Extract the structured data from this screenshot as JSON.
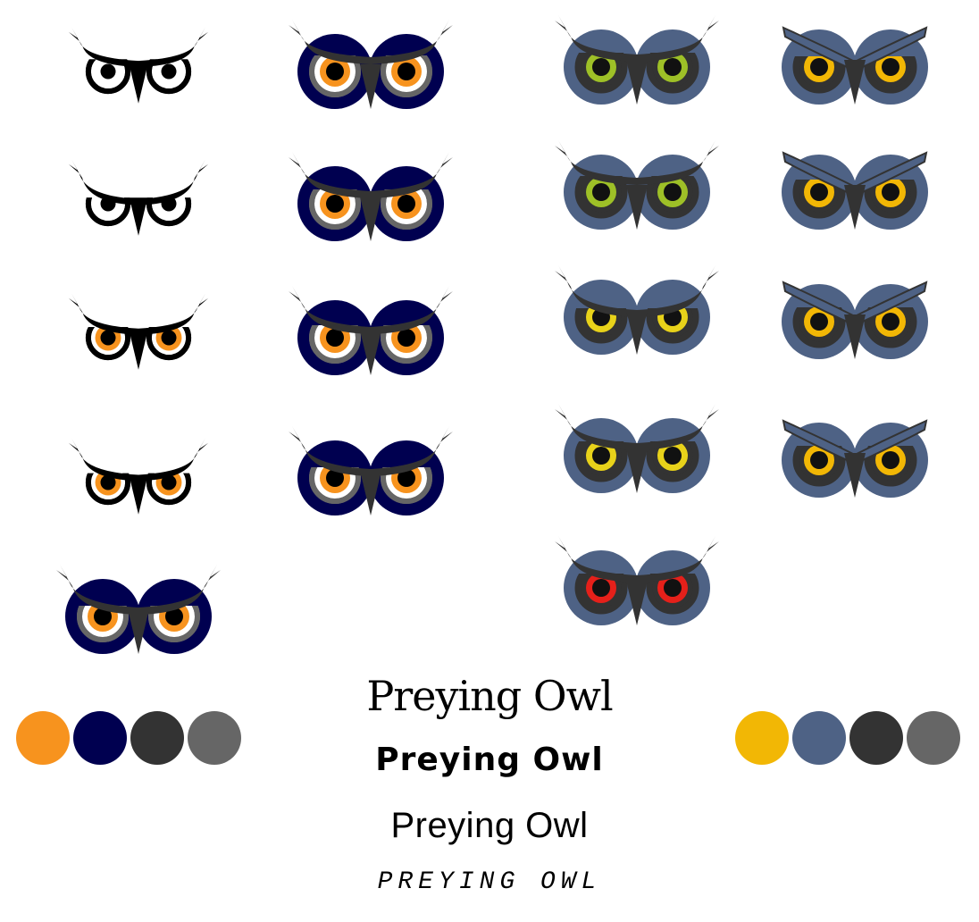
{
  "title_samples": [
    "Preying Owl",
    "Preying Owl",
    "Preying Owl",
    "PREYING OWL"
  ],
  "palettes": {
    "left": [
      "#f7931e",
      "#000050",
      "#333333",
      "#666666"
    ],
    "right": [
      "#f2b705",
      "#4e6285",
      "#333333",
      "#666666"
    ]
  },
  "owls": [
    {
      "style": "outline",
      "iris": "#ffffff",
      "lid": 0.3
    },
    {
      "style": "outline",
      "iris": "#ffffff",
      "lid": 0.5
    },
    {
      "style": "outline",
      "iris": "#f7931e",
      "lid": 0.35
    },
    {
      "style": "outline",
      "iris": "#f7931e",
      "lid": 0.4
    },
    {
      "style": "navy",
      "iris": "#f7931e",
      "lid": 0.4
    },
    {
      "style": "navy",
      "iris": "#f7931e",
      "lid": 0.25
    },
    {
      "style": "navy",
      "iris": "#f7931e",
      "lid": 0.3
    },
    {
      "style": "navy",
      "iris": "#f7931e",
      "lid": 0.35
    },
    {
      "style": "navy",
      "iris": "#f7931e",
      "lid": 0.4
    },
    {
      "style": "slate",
      "iris": "#9ec027",
      "lid": 0.3
    },
    {
      "style": "slate",
      "iris": "#9ec027",
      "lid": 0.25
    },
    {
      "style": "slate",
      "iris": "#e8d21a",
      "lid": 0.45
    },
    {
      "style": "slate",
      "iris": "#e8d21a",
      "lid": 0.3
    },
    {
      "style": "slate",
      "iris": "#e5201a",
      "lid": 0.3
    },
    {
      "style": "angry",
      "iris": "#f2b705",
      "lid": 0.4
    },
    {
      "style": "angry",
      "iris": "#f2b705",
      "lid": 0.35
    },
    {
      "style": "angry",
      "iris": "#f2b705",
      "lid": 0.3
    },
    {
      "style": "angry",
      "iris": "#f2b705",
      "lid": 0.3
    }
  ]
}
